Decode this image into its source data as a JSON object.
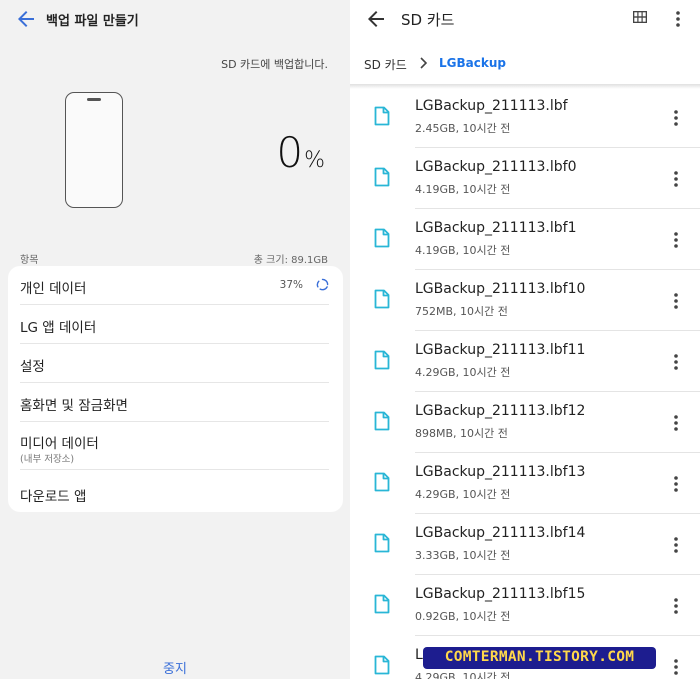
{
  "left": {
    "title": "백업 파일 만들기",
    "sd_note": "SD 카드에 백업합니다.",
    "progress_number": "0",
    "progress_unit": "%",
    "section_label": "항목",
    "total_size": "총 크기: 89.1GB",
    "items": [
      {
        "label": "개인 데이터",
        "percent": "37%"
      },
      {
        "label": "LG 앱 데이터"
      },
      {
        "label": "설정"
      },
      {
        "label": "홈화면 및 잠금화면"
      },
      {
        "label": "미디어 데이터",
        "sub": "(내부 저장소)"
      },
      {
        "label": "다운로드 앱"
      }
    ],
    "stop_label": "중지"
  },
  "right": {
    "title": "SD 카드",
    "breadcrumb": [
      "SD 카드",
      "LGBackup"
    ],
    "files": [
      {
        "name": "LGBackup_211113.lbf",
        "meta": "2.45GB, 10시간 전"
      },
      {
        "name": "LGBackup_211113.lbf0",
        "meta": "4.19GB, 10시간 전"
      },
      {
        "name": "LGBackup_211113.lbf1",
        "meta": "4.19GB, 10시간 전"
      },
      {
        "name": "LGBackup_211113.lbf10",
        "meta": "752MB, 10시간 전"
      },
      {
        "name": "LGBackup_211113.lbf11",
        "meta": "4.29GB, 10시간 전"
      },
      {
        "name": "LGBackup_211113.lbf12",
        "meta": "898MB, 10시간 전"
      },
      {
        "name": "LGBackup_211113.lbf13",
        "meta": "4.29GB, 10시간 전"
      },
      {
        "name": "LGBackup_211113.lbf14",
        "meta": "3.33GB, 10시간 전"
      },
      {
        "name": "LGBackup_211113.lbf15",
        "meta": "0.92GB, 10시간 전"
      },
      {
        "name": "L",
        "meta": "4.29GB, 10시간 전"
      }
    ]
  },
  "watermark": "COMTERMAN.TISTORY.COM",
  "colors": {
    "accent_blue": "#1a73e8",
    "stop_blue": "#3a6fd8",
    "file_icon": "#29b6d6",
    "watermark_bg": "#1d1d8f",
    "watermark_text": "#ffd84a"
  },
  "icons": [
    "back-arrow-icon",
    "phone-icon",
    "spinner-icon",
    "grid-view-icon",
    "more-vert-icon",
    "chevron-right-icon",
    "file-icon"
  ]
}
